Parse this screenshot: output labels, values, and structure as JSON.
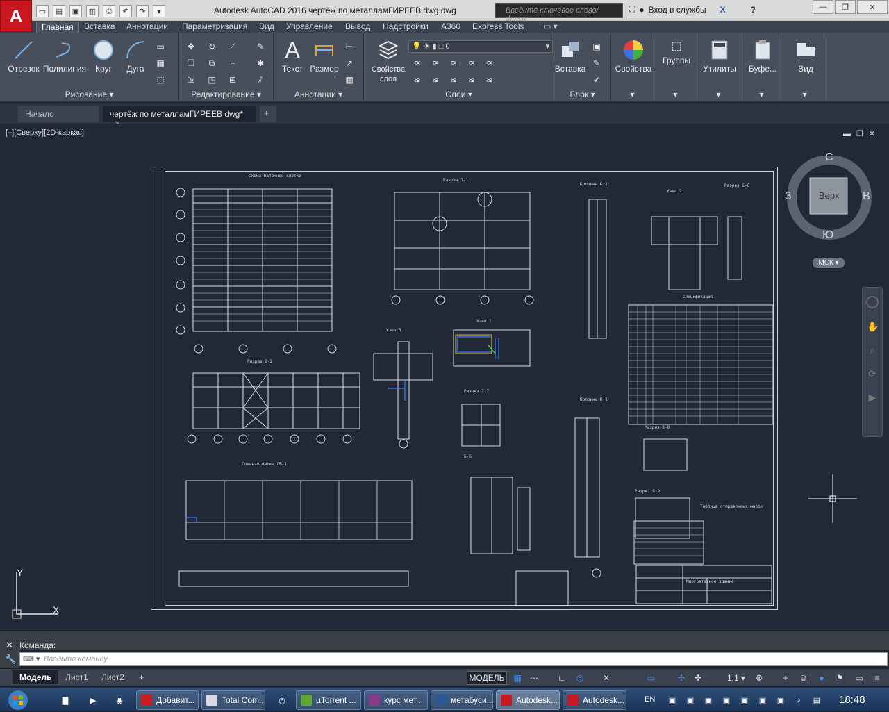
{
  "titlebar": {
    "app_title": "Autodesk AutoCAD 2016    чертёж по металламГИРЕЕВ dwg.dwg",
    "search_placeholder": "Введите ключевое слово/фразу",
    "signin_label": "Вход в службы",
    "help_label": "?"
  },
  "ribbon_tabs": [
    "Главная",
    "Вставка",
    "Аннотации",
    "Параметризация",
    "Вид",
    "Управление",
    "Вывод",
    "Надстройки",
    "A360",
    "Express Tools"
  ],
  "ribbon": {
    "draw": {
      "title": "Рисование",
      "line": "Отрезок",
      "polyline": "Полилиния",
      "circle": "Круг",
      "arc": "Дуга"
    },
    "modify": {
      "title": "Редактирование"
    },
    "annotation": {
      "title": "Аннотации",
      "text": "Текст",
      "dimension": "Размер"
    },
    "layers": {
      "title": "Слои",
      "properties": "Свойства слоя",
      "current_layer": "0"
    },
    "block": {
      "title": "Блок",
      "insert": "Вставка"
    },
    "properties": {
      "label": "Свойства"
    },
    "groups": {
      "label": "Группы"
    },
    "utilities": {
      "label": "Утилиты"
    },
    "clipboard": {
      "label": "Буфе..."
    },
    "view": {
      "label": "Вид"
    }
  },
  "doc_tabs": {
    "start": "Начало",
    "current": "чертёж по металламГИРЕЕВ dwg*"
  },
  "viewport": {
    "label": "[–][Сверху][2D-каркас]",
    "viewcube": {
      "north": "С",
      "south": "Ю",
      "west": "З",
      "east": "В",
      "face": "Верх",
      "ucs": "МСК"
    },
    "ucs_x": "X",
    "ucs_y": "Y"
  },
  "command": {
    "history_label": "Команда:",
    "placeholder": "Введите команду"
  },
  "layout_tabs": [
    "Модель",
    "Лист1",
    "Лист2"
  ],
  "status": {
    "model": "МОДЕЛЬ",
    "scale": "1:1"
  },
  "taskbar": {
    "items": [
      "Добавит...",
      "Total Com...",
      "µTorrent ...",
      "курс мет...",
      "метабуси...",
      "Autodesk...",
      "Autodesk..."
    ],
    "lang": "EN",
    "clock": "18:48"
  },
  "colors": {
    "accent": "#c8171e",
    "ribbon": "#474e5c",
    "viewport": "#212836"
  }
}
